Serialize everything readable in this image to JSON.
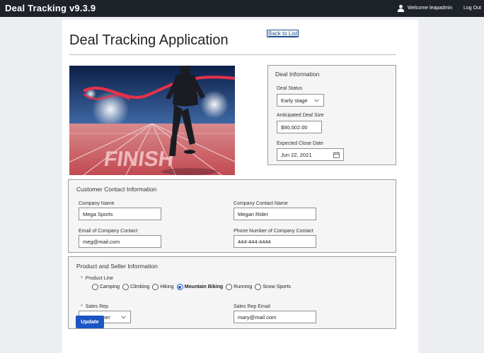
{
  "topbar": {
    "app_title": "Deal Tracking v9.3.9",
    "welcome": "Welcome leapadmin",
    "logout": "Log Out"
  },
  "page": {
    "back_link": "Back to List",
    "title": "Deal Tracking Application"
  },
  "hero_image": {
    "track_text": "FINISH"
  },
  "deal_info": {
    "title": "Deal Information",
    "status_label": "Deal Status",
    "status_value": "Early stage",
    "size_label": "Anticipated Deal Size",
    "size_value": "$90,002.00",
    "close_label": "Expected Close Date",
    "close_value": "Jun 22, 2021"
  },
  "customer": {
    "title": "Customer Contact Information",
    "company_name_label": "Company Name",
    "company_name_value": "Mega Sports",
    "contact_name_label": "Company Contact Name",
    "contact_name_value": "Megan Rider",
    "email_label": "Email of Company Contact",
    "email_value": "meg@mail.com",
    "phone_label": "Phone Number of Company Contact",
    "phone_value": "444-444-4444"
  },
  "product": {
    "title": "Product and Seller Information",
    "product_line_label": "Product Line",
    "options": [
      "Camping",
      "Climbing",
      "Hiking",
      "Mountain Biking",
      "Running",
      "Snow Sports"
    ],
    "selected": "Mountain Biking",
    "sales_rep_label": "Sales Rep",
    "sales_rep_value": "Joe Runner",
    "sales_rep_email_label": "Sales Rep Email",
    "sales_rep_email_value": "mary@mail.com"
  },
  "actions": {
    "update_label": "Update"
  },
  "colors": {
    "topbar": "#1e2329",
    "primary": "#1a55c4",
    "required": "#c0252b",
    "panel_bg": "#f5f5f5"
  }
}
